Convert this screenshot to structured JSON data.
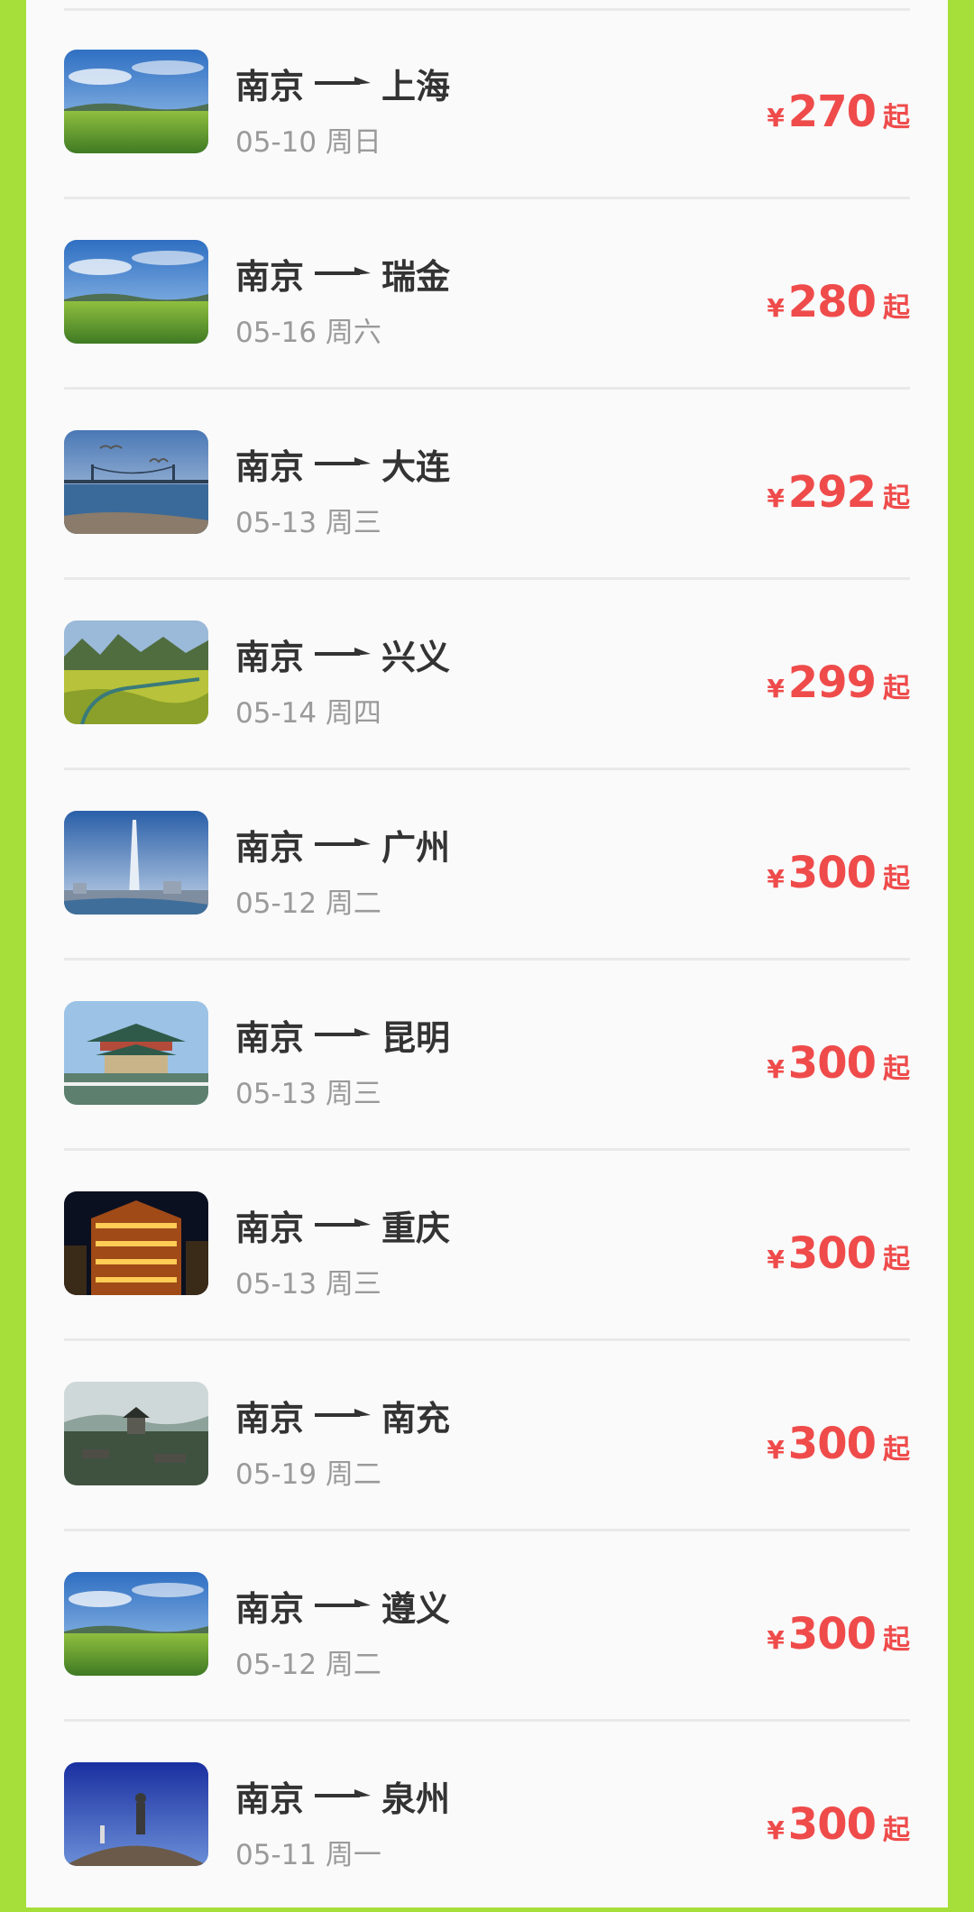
{
  "routes": [
    {
      "from": "南京",
      "to": "上海",
      "date": "05-10 周日",
      "currency": "¥",
      "price": "270",
      "suffix": "起",
      "image": "grassland-image"
    },
    {
      "from": "南京",
      "to": "瑞金",
      "date": "05-16 周六",
      "currency": "¥",
      "price": "280",
      "suffix": "起",
      "image": "grassland-image"
    },
    {
      "from": "南京",
      "to": "大连",
      "date": "05-13 周三",
      "currency": "¥",
      "price": "292",
      "suffix": "起",
      "image": "seaside-bridge-image"
    },
    {
      "from": "南京",
      "to": "兴义",
      "date": "05-14 周四",
      "currency": "¥",
      "price": "299",
      "suffix": "起",
      "image": "karst-valley-image"
    },
    {
      "from": "南京",
      "to": "广州",
      "date": "05-12 周二",
      "currency": "¥",
      "price": "300",
      "suffix": "起",
      "image": "city-tower-image"
    },
    {
      "from": "南京",
      "to": "昆明",
      "date": "05-13 周三",
      "currency": "¥",
      "price": "300",
      "suffix": "起",
      "image": "pavilion-image"
    },
    {
      "from": "南京",
      "to": "重庆",
      "date": "05-13 周三",
      "currency": "¥",
      "price": "300",
      "suffix": "起",
      "image": "night-building-image"
    },
    {
      "from": "南京",
      "to": "南充",
      "date": "05-19 周二",
      "currency": "¥",
      "price": "300",
      "suffix": "起",
      "image": "ancient-town-image"
    },
    {
      "from": "南京",
      "to": "遵义",
      "date": "05-12 周二",
      "currency": "¥",
      "price": "300",
      "suffix": "起",
      "image": "grassland-image"
    },
    {
      "from": "南京",
      "to": "泉州",
      "date": "05-11 周一",
      "currency": "¥",
      "price": "300",
      "suffix": "起",
      "image": "statue-hill-image"
    }
  ],
  "colors": {
    "background": "#a6df3a",
    "panel": "#fafafa",
    "price": "#ef4b4b",
    "title": "#333333",
    "date": "#9a9a9a"
  }
}
